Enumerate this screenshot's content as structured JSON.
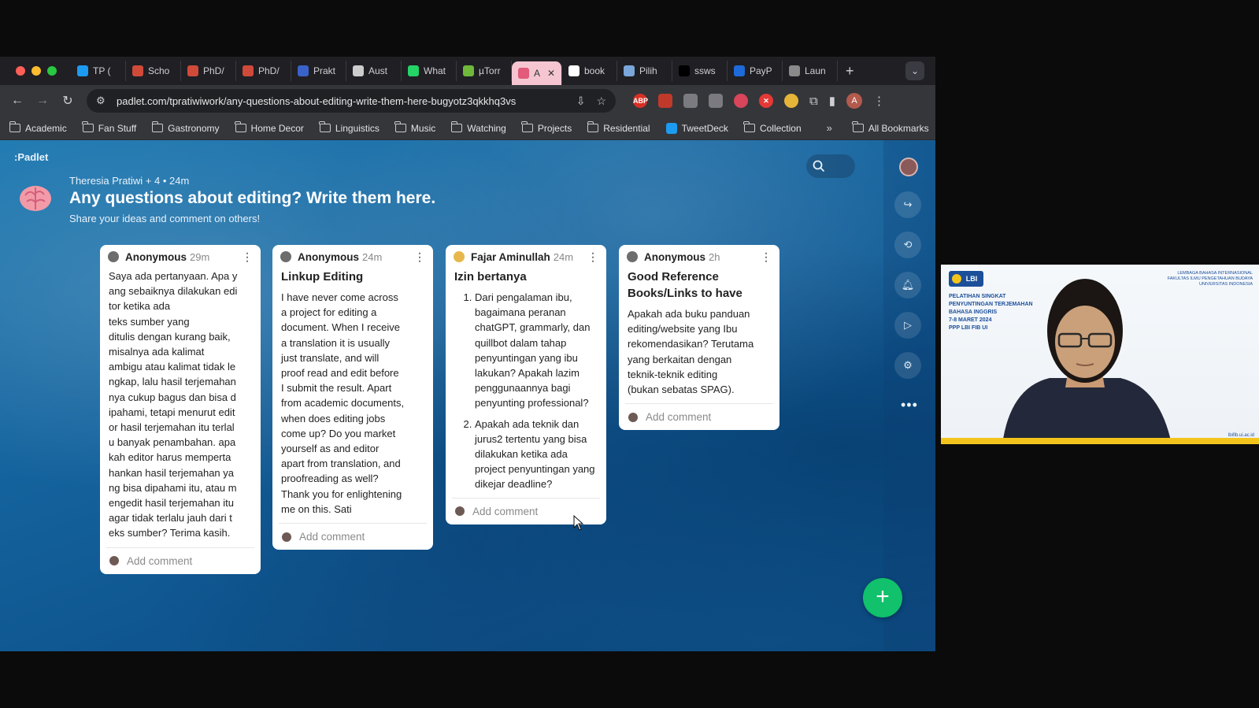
{
  "browser": {
    "tabs": [
      {
        "label": "TP (",
        "fav_color": "#1d9bf0",
        "icon": "butterfly-icon"
      },
      {
        "label": "Scho",
        "fav_color": "#d04a3a",
        "icon": "asterisk-icon"
      },
      {
        "label": "PhD/",
        "fav_color": "#d04a3a",
        "icon": "asterisk-icon"
      },
      {
        "label": "PhD/",
        "fav_color": "#d04a3a",
        "icon": "asterisk-icon"
      },
      {
        "label": "Prakt",
        "fav_color": "#3a63c9",
        "icon": "line-icon"
      },
      {
        "label": "Aust",
        "fav_color": "#cccccc",
        "icon": "document-icon"
      },
      {
        "label": "What",
        "fav_color": "#25d366",
        "icon": "whatsapp-icon"
      },
      {
        "label": "µTorr",
        "fav_color": "#6fb83b",
        "icon": "utorrent-icon"
      },
      {
        "label": "A",
        "fav_color": "#e25b7a",
        "icon": "padlet-icon",
        "active": true
      },
      {
        "label": "book",
        "fav_color": "#ffffff",
        "icon": "google-icon"
      },
      {
        "label": "Pilih",
        "fav_color": "#7aa6d9",
        "icon": "document-icon"
      },
      {
        "label": "ssws",
        "fav_color": "#000000",
        "icon": "x-icon"
      },
      {
        "label": "PayP",
        "fav_color": "#1e6ad9",
        "icon": "paypal-icon"
      },
      {
        "label": "Laun",
        "fav_color": "#8a8a8a",
        "icon": "globe-icon"
      }
    ],
    "new_tab": "+",
    "url": "padlet.com/tpratiwiwork/any-questions-about-editing-write-them-here-bugyotz3qkkhq3vs",
    "profile_initial": "A",
    "bookmarks": [
      "Academic",
      "Fan Stuff",
      "Gastronomy",
      "Home Decor",
      "Linguistics",
      "Music",
      "Watching",
      "Projects",
      "Residential",
      "TweetDeck",
      "Collection"
    ],
    "all_bookmarks": "All Bookmarks",
    "more_bookmarks": "»"
  },
  "padlet": {
    "logo": ":Padlet",
    "meta": "Theresia Pratiwi + 4 • 24m",
    "title": "Any questions about editing? Write them here.",
    "subtitle": "Share your ideas and comment on others!",
    "fab": "+",
    "more": "•••",
    "add_comment": "Add comment",
    "cards": [
      {
        "author": "Anonymous",
        "time": "29m",
        "title": "",
        "body": "Saya ada pertanyaan. Apa y\nang sebaiknya dilakukan edi\ntor ketika ada\nteks sumber yang\nditulis dengan kurang baik,\nmisalnya ada kalimat\nambigu atau kalimat tidak le\nngkap, lalu hasil terjemahan\nnya cukup bagus dan bisa d\nipahami, tetapi menurut edit\nor hasil terjemahan itu terlal\nu banyak penambahan. apa\nkah editor harus memperta\nhankan hasil terjemahan ya\nng bisa dipahami itu, atau m\nengedit hasil terjemahan itu\n agar tidak terlalu jauh dari t\neks sumber? Terima kasih."
      },
      {
        "author": "Anonymous",
        "time": "24m",
        "title": "Linkup Editing",
        "body": "I have never come across\na project for editing a\ndocument. When I receive\na translation it is usually\njust translate, and will\nproof read and edit before\nI submit the result. Apart\nfrom academic documents,\nwhen does editing jobs\ncome up? Do you market\nyourself as and editor\napart from translation, and\nproofreading as well?\nThank you for enlightening\nme on this. Sati"
      },
      {
        "author": "Fajar Aminullah",
        "time": "24m",
        "title": "Izin bertanya",
        "items": [
          "Dari pengalaman ibu, bagaimana peranan chatGPT, grammarly, dan quillbot dalam tahap penyuntingan yang ibu lakukan? Apakah lazim penggunaannya bagi penyunting professional?",
          "Apakah ada teknik dan jurus2 tertentu yang bisa dilakukan ketika ada project penyuntingan yang dikejar deadline?"
        ]
      },
      {
        "author": "Anonymous",
        "time": "2h",
        "title": "Good Reference Books/Links to have",
        "body": "Apakah ada buku panduan\nediting/website yang Ibu\nrekomendasikan? Terutama\nyang berkaitan dengan\nteknik-teknik editing\n(bukan sebatas SPAG)."
      }
    ]
  },
  "webcam": {
    "logo_text": "LBI",
    "event": "PELATIHAN SINGKAT\nPENYUNTINGAN TERJEMAHAN\nBAHASA INGGRIS\n7-8 MARET 2024\nPPP LBI FIB UI",
    "org": "LEMBAGA BAHASA INTERNASIONAL\nFAKULTAS ILMU PENGETAHUAN BUDAYA\nUNIVERSITAS INDONESIA",
    "url": "lbifib.ui.ac.id"
  },
  "colors": {
    "accent_fab": "#11c16b",
    "card_bg": "#ffffff",
    "active_tab": "#f5c6d2"
  }
}
